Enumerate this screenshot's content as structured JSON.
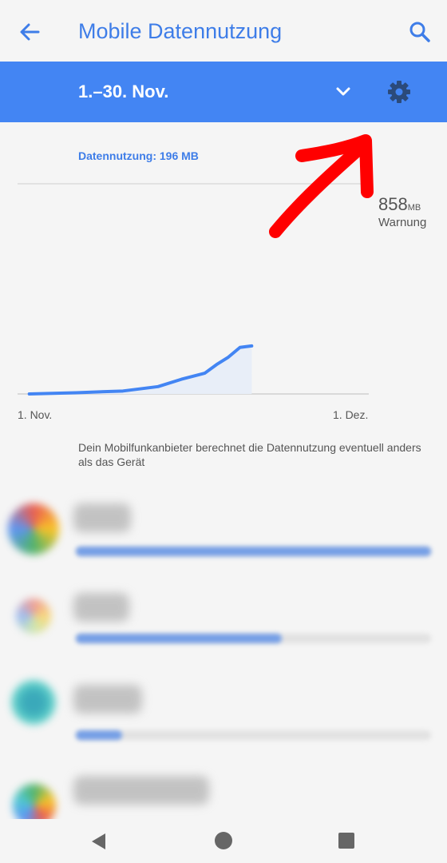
{
  "appbar": {
    "title": "Mobile Datennutzung",
    "back_icon": "arrow-back-icon",
    "search_icon": "search-icon"
  },
  "cycle": {
    "label": "1.–30. Nov.",
    "dropdown_icon": "chevron-down-icon",
    "settings_icon": "gear-icon"
  },
  "usage": {
    "summary": "Datennutzung: 196 MB"
  },
  "chart_data": {
    "type": "line",
    "x_labels": [
      "1. Nov.",
      "1. Dez."
    ],
    "x": [
      1,
      5,
      9,
      12,
      14,
      16,
      17,
      18,
      19,
      20
    ],
    "values": [
      0,
      5,
      12,
      30,
      60,
      85,
      120,
      150,
      190,
      196
    ],
    "warning": {
      "value": "858",
      "unit": "MB",
      "label": "Warnung"
    },
    "ylim": [
      0,
      858
    ],
    "colors": {
      "line": "#4385f3",
      "grid": "#d0d0d0"
    }
  },
  "notice": "Dein Mobilfunkanbieter berechnet die Datennutzung eventuell anders als das Gerät",
  "app_list": {
    "usage_fractions": [
      1.0,
      0.58,
      0.13,
      0.0
    ]
  },
  "navbar": {
    "back_icon": "nav-back-icon",
    "home_icon": "nav-home-icon",
    "recent_icon": "nav-recent-icon"
  },
  "colors": {
    "accent": "#4385f3",
    "title": "#3e7de8",
    "background": "#f5f5f5",
    "annotation": "#ff0000"
  }
}
